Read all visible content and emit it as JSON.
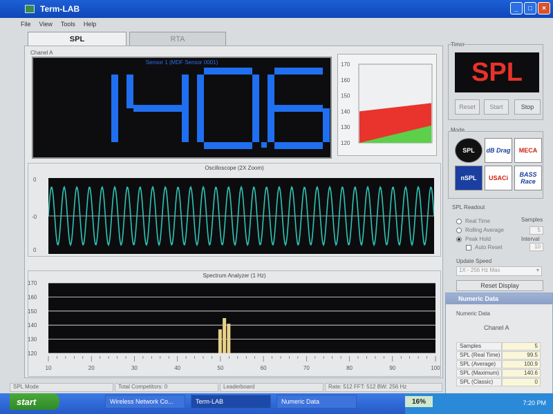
{
  "window": {
    "title": "Term-LAB"
  },
  "menu": [
    "File",
    "View",
    "Tools",
    "Help"
  ],
  "tabs": [
    {
      "label": "SPL",
      "active": true
    },
    {
      "label": "RTA",
      "active": false
    }
  ],
  "channel": {
    "label": "Chanel A",
    "sensor": "Sensor 1 (MDF Sensor 0001)",
    "reading": "140.6",
    "reading_digits": [
      "1",
      "4",
      "0",
      "6"
    ],
    "digit_color": "#1f6ff0"
  },
  "meter": {
    "ticks": [
      "170",
      "160",
      "150",
      "140",
      "130",
      "120"
    ],
    "red_level": 140,
    "green_level": 131
  },
  "oscilloscope": {
    "title": "Oscilloscope (2X Zoom)",
    "y_ticks": [
      "0",
      "-0",
      "0"
    ],
    "wave_color": "#2ec6b8"
  },
  "spectrum": {
    "title": "Spectrum Analyzer (1 Hz)",
    "y_ticks": [
      "170",
      "160",
      "150",
      "140",
      "130",
      "120"
    ],
    "x_ticks": [
      "10",
      "20",
      "30",
      "40",
      "50",
      "60",
      "70",
      "80",
      "90",
      "100"
    ]
  },
  "chart_data": {
    "type": "bar",
    "title": "Spectrum Analyzer (1 Hz)",
    "xlim": [
      10,
      100
    ],
    "ylim": [
      120,
      170
    ],
    "x": [
      50,
      51,
      52
    ],
    "values": [
      137,
      145,
      141
    ],
    "bar_color": "#e8d28a"
  },
  "timer": {
    "label": "Timer",
    "display": "SPL",
    "reset_label": "Reset",
    "start_label": "Start",
    "stop_label": "Stop"
  },
  "mode": {
    "label": "Mode",
    "logos": [
      "SPL",
      "dB Drag",
      "MECA",
      "nSPL",
      "USACi",
      "BASS Race"
    ]
  },
  "readout": {
    "label": "SPL Readout",
    "samples_label": "Samples",
    "samples_value": "5",
    "interval_label": "Interval",
    "interval_value": "10",
    "options": [
      "Real Time",
      "Rolling Average",
      "Peak Hold"
    ],
    "selected": "Peak Hold",
    "auto_reset_label": "Auto Reset",
    "update_speed_label": "Update Speed",
    "update_speed_value": "1X - 256 Hz Max",
    "reset_display_label": "Reset Display"
  },
  "numeric": {
    "title": "Numeric Data",
    "section": "Numeric Data",
    "channel": "Chanel A",
    "rows": [
      {
        "k": "Samples",
        "v": "5"
      },
      {
        "k": "SPL (Real Time)",
        "v": "99.5"
      },
      {
        "k": "SPL (Average)",
        "v": "100.9"
      },
      {
        "k": "SPL (Maximum)",
        "v": "140.6"
      },
      {
        "k": "SPL (Classic)",
        "v": "0"
      }
    ]
  },
  "status": {
    "mode": "SPL Mode",
    "competitors": "Total Competitors: 0",
    "leaderboard": "Leaderboard",
    "rate": "Rate: 512 FFT: 512 BW: 256 Hz"
  },
  "taskbar": {
    "start": "start",
    "tasks": [
      "Wireless Network Co...",
      "Term-LAB",
      "Numeric Data"
    ],
    "active_task": "Term-LAB",
    "percent": "16%",
    "clock": "7:20 PM"
  }
}
